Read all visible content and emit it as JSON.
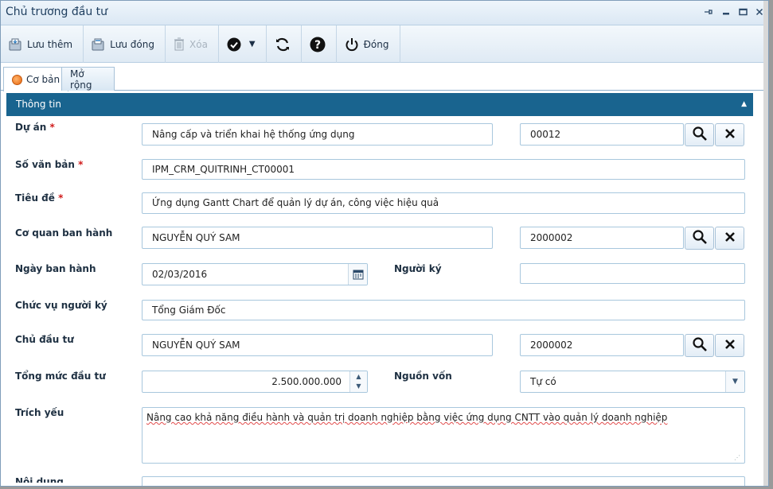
{
  "window": {
    "title": "Chủ trương đầu tư"
  },
  "toolbar": {
    "save_more": "Lưu thêm",
    "save_close": "Lưu đóng",
    "delete": "Xóa",
    "close": "Đóng"
  },
  "tabs": [
    {
      "label": "Cơ bản",
      "active": true
    },
    {
      "label": "Mở rộng",
      "active": false
    }
  ],
  "section": {
    "title": "Thông tin"
  },
  "form": {
    "du_an": {
      "label": "Dự án",
      "value": "Nâng cấp và triển khai hệ thống ứng dụng",
      "code": "00012"
    },
    "so_van_ban": {
      "label": "Số văn bản",
      "value": "IPM_CRM_QUITRINH_CT00001"
    },
    "tieu_de": {
      "label": "Tiêu đề",
      "value": "Ứng dụng Gantt Chart để quản lý dự án, công việc hiệu quả"
    },
    "co_quan": {
      "label": "Cơ quan ban hành",
      "value": "NGUYỄN QUÝ SAM",
      "code": "2000002"
    },
    "ngay_ban_hanh": {
      "label": "Ngày ban hành",
      "value": "02/03/2016"
    },
    "nguoi_ky": {
      "label": "Người ký",
      "value": ""
    },
    "chuc_vu": {
      "label": "Chức vụ người ký",
      "value": "Tổng Giám Đốc"
    },
    "chu_dau_tu": {
      "label": "Chủ đầu tư",
      "value": "NGUYỄN QUÝ SAM",
      "code": "2000002"
    },
    "tong_muc": {
      "label": "Tổng mức đầu tư",
      "value": "2.500.000.000"
    },
    "nguon_von": {
      "label": "Nguồn vốn",
      "value": "Tự có"
    },
    "trich_yeu": {
      "label": "Trích yếu",
      "value": "Nâng cao khả năng điều hành và quản trị doanh nghiệp bằng việc ứng dụng CNTT vào quản lý doanh nghiệp"
    },
    "noi_dung": {
      "label": "Nội dung"
    }
  },
  "colors": {
    "section_bg": "#19648f",
    "required": "#d01b1b",
    "accent_border": "#a8c7dd"
  },
  "icons": [
    "pin-icon",
    "minimize-icon",
    "maximize-icon",
    "close-icon",
    "save-icon",
    "save-close-icon",
    "trash-icon",
    "check-icon",
    "refresh-icon",
    "help-icon",
    "power-icon",
    "search-icon",
    "clear-icon",
    "calendar-icon"
  ]
}
